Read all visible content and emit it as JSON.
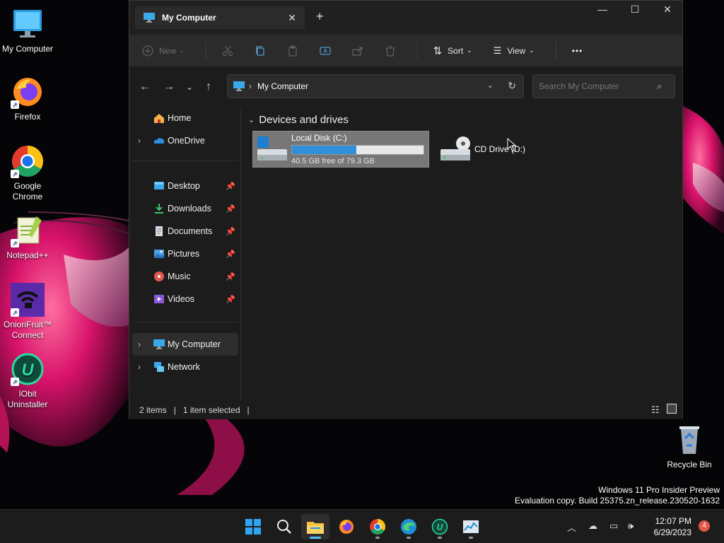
{
  "desktop": {
    "icons": [
      {
        "label": "My Computer",
        "icon": "computer-icon",
        "shortcut": false
      },
      {
        "label": "Firefox",
        "icon": "firefox-icon",
        "shortcut": true
      },
      {
        "label": "Google Chrome",
        "icon": "chrome-icon",
        "shortcut": true
      },
      {
        "label": "Notepad++",
        "icon": "notepadpp-icon",
        "shortcut": true
      },
      {
        "label": "OnionFruit™ Connect",
        "icon": "onionfruit-icon",
        "shortcut": true
      },
      {
        "label": "IObit Uninstaller",
        "icon": "iobit-icon",
        "shortcut": true
      }
    ],
    "recycle_bin": "Recycle Bin"
  },
  "window": {
    "tab_title": "My Computer",
    "toolbar": {
      "new": "New",
      "sort": "Sort",
      "view": "View",
      "more": "•••"
    },
    "address": {
      "path": "My Computer"
    },
    "search": {
      "placeholder": "Search My Computer"
    },
    "sidebar": {
      "items": [
        {
          "label": "Home",
          "icon": "home-icon",
          "expandable": false,
          "pinned": false
        },
        {
          "label": "OneDrive",
          "icon": "onedrive-icon",
          "expandable": true,
          "pinned": false
        },
        {
          "label": "Desktop",
          "icon": "desktop-folder-icon",
          "expandable": false,
          "pinned": true
        },
        {
          "label": "Downloads",
          "icon": "downloads-icon",
          "expandable": false,
          "pinned": true
        },
        {
          "label": "Documents",
          "icon": "documents-icon",
          "expandable": false,
          "pinned": true
        },
        {
          "label": "Pictures",
          "icon": "pictures-icon",
          "expandable": false,
          "pinned": true
        },
        {
          "label": "Music",
          "icon": "music-icon",
          "expandable": false,
          "pinned": true
        },
        {
          "label": "Videos",
          "icon": "videos-icon",
          "expandable": false,
          "pinned": true
        },
        {
          "label": "My Computer",
          "icon": "computer-icon",
          "expandable": true,
          "pinned": false,
          "selected": true
        },
        {
          "label": "Network",
          "icon": "network-icon",
          "expandable": true,
          "pinned": false
        }
      ]
    },
    "content": {
      "group_title": "Devices and drives",
      "drives": [
        {
          "name": "Local Disk (C:)",
          "free_text": "40.5 GB free of 79.3 GB",
          "used_fraction": 0.49,
          "selected": true
        },
        {
          "name": "CD Drive (D:)",
          "selected": false
        }
      ]
    },
    "status": {
      "items": "2 items",
      "selected": "1 item selected"
    }
  },
  "watermark": {
    "line1": "Windows 11 Pro Insider Preview",
    "line2": "Evaluation copy. Build 25375.zn_release.230520-1632"
  },
  "taskbar": {
    "apps": [
      "start-icon",
      "search-icon",
      "file-explorer-icon",
      "firefox-icon",
      "chrome-icon",
      "edge-icon",
      "iobit-icon",
      "task-manager-icon"
    ],
    "time": "12:07 PM",
    "date": "6/29/2023",
    "notifications": "4"
  },
  "colors": {
    "accent": "#4cc2ff",
    "drive_bar": "#2f8fd8",
    "window_bg": "#1c1c1c",
    "toolbar_bg": "#2b2b2b"
  }
}
